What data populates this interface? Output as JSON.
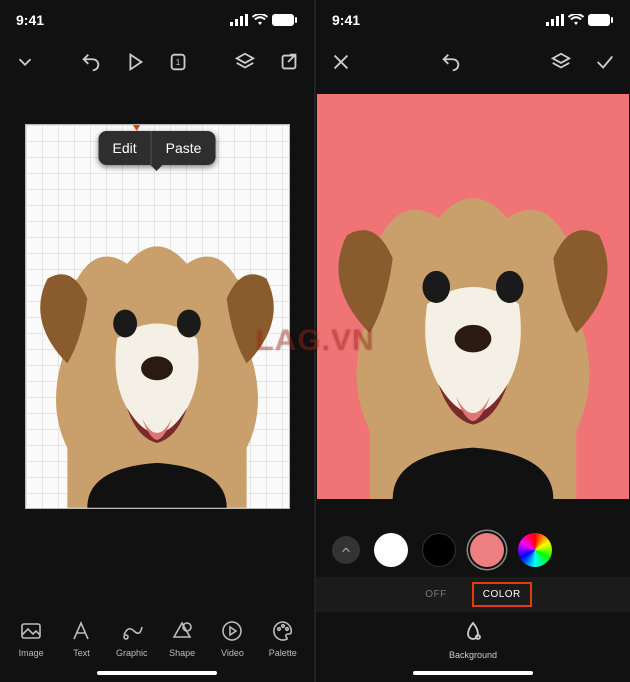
{
  "status": {
    "time": "9:41"
  },
  "left": {
    "popup": {
      "edit": "Edit",
      "paste": "Paste"
    },
    "tools": {
      "image": "Image",
      "text": "Text",
      "graphic": "Graphic",
      "shape": "Shape",
      "video": "Video",
      "palette": "Palette"
    }
  },
  "right": {
    "tabs": {
      "off": "OFF",
      "color": "COLOR"
    },
    "bg_label": "Background",
    "colors": {
      "selected": "#ed7f80"
    }
  },
  "watermark": "LAG.VN"
}
